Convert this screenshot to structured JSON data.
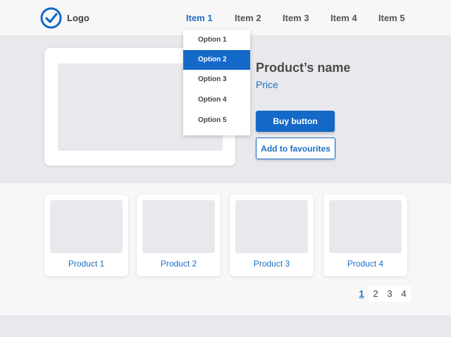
{
  "header": {
    "logo_text": "Logo",
    "nav": [
      {
        "label": "Item 1",
        "active": true
      },
      {
        "label": "Item 2",
        "active": false
      },
      {
        "label": "Item 3",
        "active": false
      },
      {
        "label": "Item 4",
        "active": false
      },
      {
        "label": "Item 5",
        "active": false
      }
    ]
  },
  "dropdown": {
    "options": [
      "Option 1",
      "Option 2",
      "Option 3",
      "Option 4",
      "Option 5"
    ],
    "selected": "Option 2"
  },
  "product": {
    "name": "Product’s name",
    "price": "Price",
    "buy_label": "Buy button",
    "favourite_label": "Add to favourites"
  },
  "products": [
    {
      "label": "Product 1"
    },
    {
      "label": "Product 2"
    },
    {
      "label": "Product 3"
    },
    {
      "label": "Product 4"
    }
  ],
  "pagination": {
    "pages": [
      "1",
      "2",
      "3",
      "4"
    ],
    "current": "1"
  },
  "colors": {
    "accent": "#1468c8",
    "link": "#1d6fc2",
    "header_bg": "#f7f7f8",
    "page_bg": "#e8e9ec"
  },
  "icons": {
    "logo": "check-circle-icon"
  }
}
